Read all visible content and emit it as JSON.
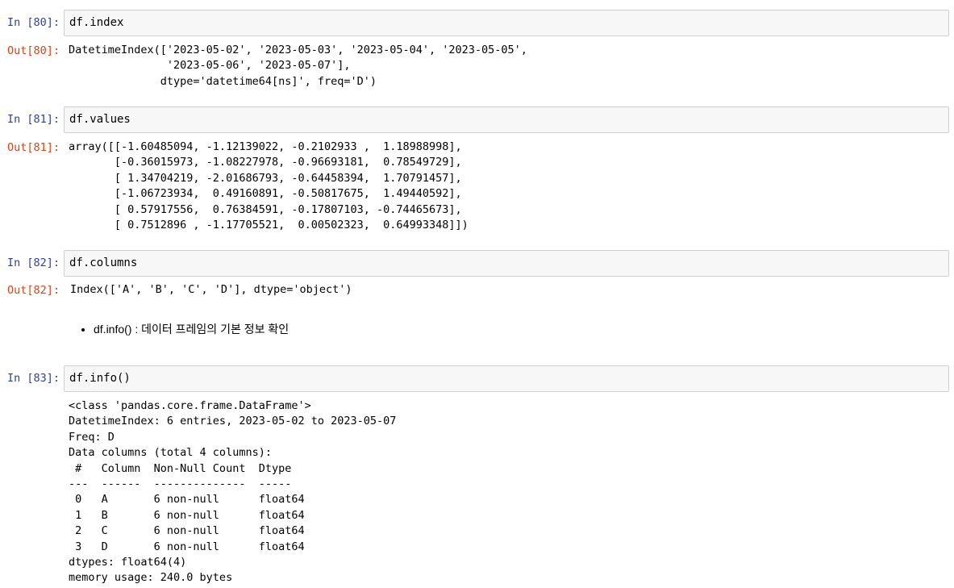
{
  "cells": [
    {
      "in_prompt": "In [80]:",
      "code": "df.index",
      "out_prompt": "Out[80]:",
      "output": "DatetimeIndex(['2023-05-02', '2023-05-03', '2023-05-04', '2023-05-05',\n               '2023-05-06', '2023-05-07'],\n              dtype='datetime64[ns]', freq='D')"
    },
    {
      "in_prompt": "In [81]:",
      "code": "df.values",
      "out_prompt": "Out[81]:",
      "output": "array([[-1.60485094, -1.12139022, -0.2102933 ,  1.18988998],\n       [-0.36015973, -1.08227978, -0.96693181,  0.78549729],\n       [ 1.34704219, -2.01686793, -0.64458394,  1.70791457],\n       [-1.06723934,  0.49160891, -0.50817675,  1.49440592],\n       [ 0.57917556,  0.76384591, -0.17807103, -0.74465673],\n       [ 0.7512896 , -1.17705521,  0.00502323,  0.64993348]])"
    },
    {
      "in_prompt": "In [82]:",
      "code": "df.columns",
      "out_prompt": "Out[82]:",
      "output": "Index(['A', 'B', 'C', 'D'], dtype='object')"
    },
    {
      "in_prompt": "In [83]:",
      "code": "df.info()",
      "output": "<class 'pandas.core.frame.DataFrame'>\nDatetimeIndex: 6 entries, 2023-05-02 to 2023-05-07\nFreq: D\nData columns (total 4 columns):\n #   Column  Non-Null Count  Dtype  \n---  ------  --------------  -----  \n 0   A       6 non-null      float64\n 1   B       6 non-null      float64\n 2   C       6 non-null      float64\n 3   D       6 non-null      float64\ndtypes: float64(4)\nmemory usage: 240.0 bytes"
    }
  ],
  "markdown": {
    "bullet": "df.info() : 데이터 프레임의 기본 정보 확인"
  },
  "colors": {
    "in_prompt": "#303f9f",
    "out_prompt": "#d84315",
    "input_background": "#f7f7f7",
    "input_border": "#cfcfcf"
  }
}
